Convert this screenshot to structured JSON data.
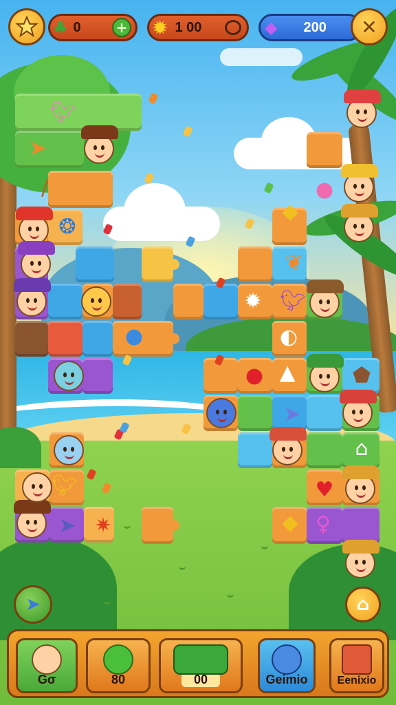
{
  "hud": {
    "star_icon": "star-icon",
    "resource_left": {
      "icon": "clover-icon",
      "value": "0",
      "add_icon": "plus-icon"
    },
    "resource_center": {
      "icon": "sun-icon",
      "value": "1 00"
    },
    "resource_right": {
      "icon": "gem-icon",
      "value": "200"
    },
    "close_icon": "close-icon"
  },
  "side_button": {
    "icon": "fish-icon"
  },
  "right_button": {
    "icon": "tooth-icon"
  },
  "bottom_bar": {
    "items": [
      {
        "label": "Gσ",
        "icon": "character-icon"
      },
      {
        "label": "80",
        "icon": "apple-icon"
      },
      {
        "label": "00",
        "icon": "hat-flower-icon"
      },
      {
        "label": "Geimio",
        "icon": "blue-creature-icon"
      },
      {
        "label": "Eenixio",
        "icon": "house-icon"
      }
    ]
  },
  "colors": {
    "hud_pill": "#d9501f",
    "button_gold": "#f7b731",
    "sky": "#46b3f0",
    "grass": "#7ecb4a"
  }
}
